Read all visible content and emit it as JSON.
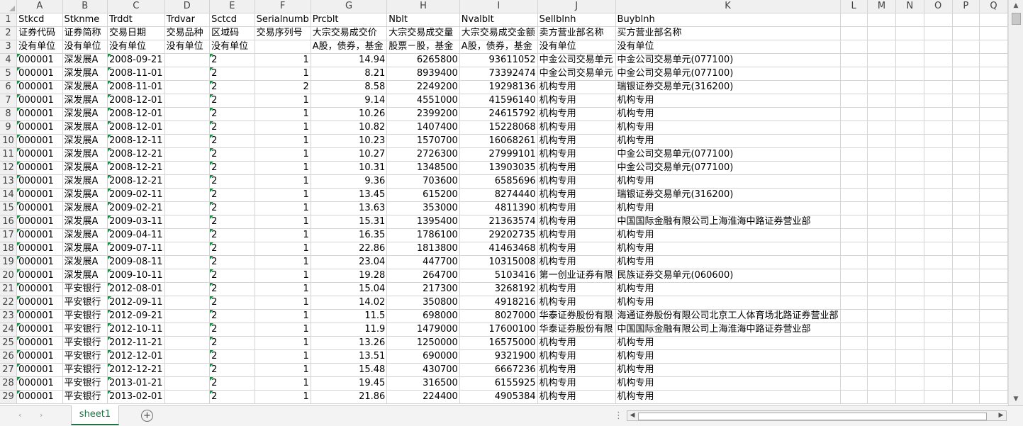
{
  "columns": [
    "A",
    "B",
    "C",
    "D",
    "E",
    "F",
    "G",
    "H",
    "I",
    "J",
    "K",
    "L",
    "M",
    "N",
    "O",
    "P",
    "Q"
  ],
  "rows": [
    [
      "Stkcd",
      "Stknme",
      "Trddt",
      "Trdvar",
      "Sctcd",
      "Serialnumb",
      "Prcblt",
      "Nblt",
      "Nvalblt",
      "Sellblnh",
      "Buyblnh"
    ],
    [
      "证券代码",
      "证券简称",
      "交易日期",
      "交易品种",
      "区域码",
      "交易序列号",
      "大宗交易成交价",
      "大宗交易成交量",
      "大宗交易成交金额",
      "卖方营业部名称",
      "买方营业部名称"
    ],
    [
      "没有单位",
      "没有单位",
      "没有单位",
      "没有单位",
      "没有单位",
      "",
      "A股，债券，基金",
      "股票－股，基金",
      "A股，债券，基金",
      "没有单位",
      "没有单位"
    ],
    [
      "000001",
      "深发展A",
      "2008-09-21",
      "2",
      "1",
      "14.94",
      "6265800",
      "93611052",
      "中金公司交易单元",
      "中金公司交易单元(077100)"
    ],
    [
      "000001",
      "深发展A",
      "2008-11-01",
      "2",
      "1",
      "8.21",
      "8939400",
      "73392474",
      "中金公司交易单元",
      "中金公司交易单元(077100)"
    ],
    [
      "000001",
      "深发展A",
      "2008-11-01",
      "2",
      "2",
      "8.58",
      "2249200",
      "19298136",
      "机构专用",
      "瑞银证券交易单元(316200)"
    ],
    [
      "000001",
      "深发展A",
      "2008-12-01",
      "2",
      "1",
      "9.14",
      "4551000",
      "41596140",
      "机构专用",
      "机构专用"
    ],
    [
      "000001",
      "深发展A",
      "2008-12-01",
      "2",
      "1",
      "10.26",
      "2399200",
      "24615792",
      "机构专用",
      "机构专用"
    ],
    [
      "000001",
      "深发展A",
      "2008-12-01",
      "2",
      "1",
      "10.82",
      "1407400",
      "15228068",
      "机构专用",
      "机构专用"
    ],
    [
      "000001",
      "深发展A",
      "2008-12-11",
      "2",
      "1",
      "10.23",
      "1570700",
      "16068261",
      "机构专用",
      "机构专用"
    ],
    [
      "000001",
      "深发展A",
      "2008-12-21",
      "2",
      "1",
      "10.27",
      "2726300",
      "27999101",
      "机构专用",
      "中金公司交易单元(077100)"
    ],
    [
      "000001",
      "深发展A",
      "2008-12-21",
      "2",
      "1",
      "10.31",
      "1348500",
      "13903035",
      "机构专用",
      "中金公司交易单元(077100)"
    ],
    [
      "000001",
      "深发展A",
      "2008-12-21",
      "2",
      "1",
      "9.36",
      "703600",
      "6585696",
      "机构专用",
      "机构专用"
    ],
    [
      "000001",
      "深发展A",
      "2009-02-11",
      "2",
      "1",
      "13.45",
      "615200",
      "8274440",
      "机构专用",
      "瑞银证券交易单元(316200)"
    ],
    [
      "000001",
      "深发展A",
      "2009-02-21",
      "2",
      "1",
      "13.63",
      "353000",
      "4811390",
      "机构专用",
      "机构专用"
    ],
    [
      "000001",
      "深发展A",
      "2009-03-11",
      "2",
      "1",
      "15.31",
      "1395400",
      "21363574",
      "机构专用",
      "中国国际金融有限公司上海淮海中路证券营业部"
    ],
    [
      "000001",
      "深发展A",
      "2009-04-11",
      "2",
      "1",
      "16.35",
      "1786100",
      "29202735",
      "机构专用",
      "机构专用"
    ],
    [
      "000001",
      "深发展A",
      "2009-07-11",
      "2",
      "1",
      "22.86",
      "1813800",
      "41463468",
      "机构专用",
      "机构专用"
    ],
    [
      "000001",
      "深发展A",
      "2009-08-11",
      "2",
      "1",
      "23.04",
      "447700",
      "10315008",
      "机构专用",
      "机构专用"
    ],
    [
      "000001",
      "深发展A",
      "2009-10-11",
      "2",
      "1",
      "19.28",
      "264700",
      "5103416",
      "第一创业证券有限",
      "民族证券交易单元(060600)"
    ],
    [
      "000001",
      "平安银行",
      "2012-08-01",
      "2",
      "1",
      "15.04",
      "217300",
      "3268192",
      "机构专用",
      "机构专用"
    ],
    [
      "000001",
      "平安银行",
      "2012-09-11",
      "2",
      "1",
      "14.02",
      "350800",
      "4918216",
      "机构专用",
      "机构专用"
    ],
    [
      "000001",
      "平安银行",
      "2012-09-21",
      "2",
      "1",
      "11.5",
      "698000",
      "8027000",
      "华泰证券股份有限",
      "海通证券股份有限公司北京工人体育场北路证券营业部"
    ],
    [
      "000001",
      "平安银行",
      "2012-10-11",
      "2",
      "1",
      "11.9",
      "1479000",
      "17600100",
      "华泰证券股份有限",
      "中国国际金融有限公司上海淮海中路证券营业部"
    ],
    [
      "000001",
      "平安银行",
      "2012-11-21",
      "2",
      "1",
      "13.26",
      "1250000",
      "16575000",
      "机构专用",
      "机构专用"
    ],
    [
      "000001",
      "平安银行",
      "2012-12-01",
      "2",
      "1",
      "13.51",
      "690000",
      "9321900",
      "机构专用",
      "机构专用"
    ],
    [
      "000001",
      "平安银行",
      "2012-12-21",
      "2",
      "1",
      "15.48",
      "430700",
      "6667236",
      "机构专用",
      "机构专用"
    ],
    [
      "000001",
      "平安银行",
      "2013-01-21",
      "2",
      "1",
      "19.45",
      "316500",
      "6155925",
      "机构专用",
      "机构专用"
    ],
    [
      "000001",
      "平安银行",
      "2013-02-01",
      "2",
      "1",
      "21.86",
      "224400",
      "4905384",
      "机构专用",
      "机构专用"
    ]
  ],
  "sheet_tab": "sheet1",
  "add_sheet_label": "+",
  "icons": {
    "scroll_up": "▲",
    "scroll_down": "▼",
    "scroll_left": "◀",
    "scroll_right": "▶",
    "tab_prev": "‹",
    "tab_next": "›",
    "more": "⋮"
  }
}
